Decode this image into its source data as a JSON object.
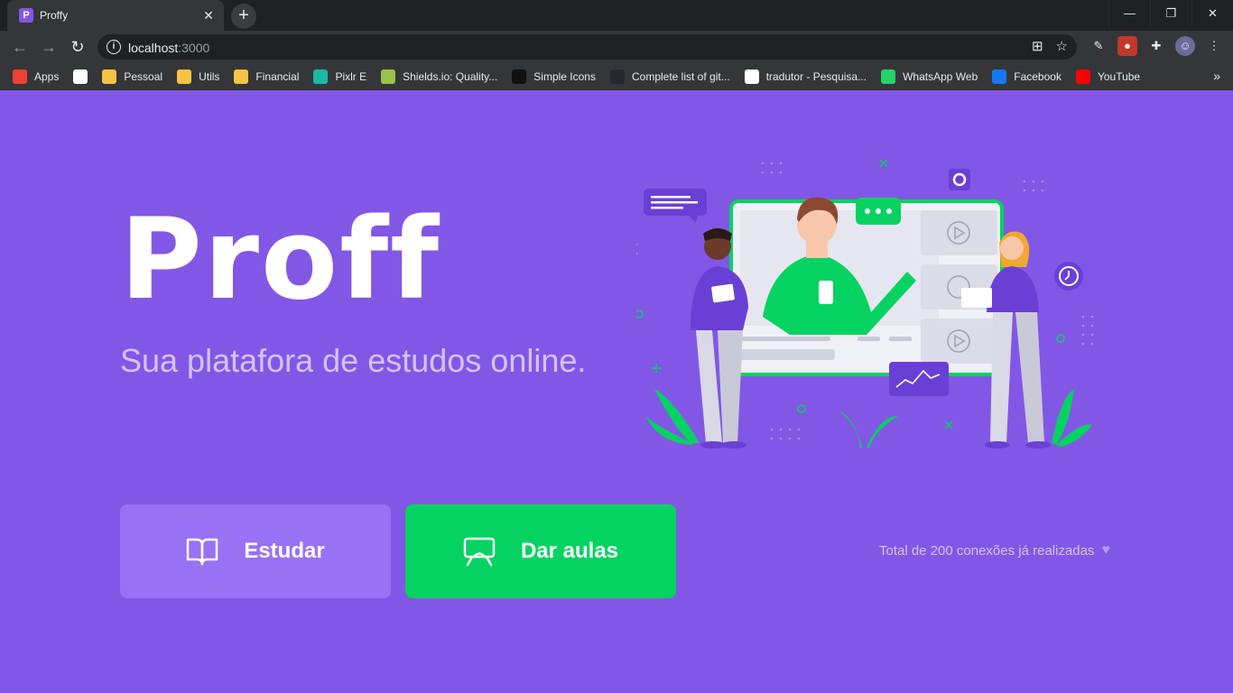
{
  "browser": {
    "tab_title": "Proffy",
    "tab_close": "✕",
    "new_tab": "+",
    "favicon_letter": "P",
    "url_host": "localhost",
    "url_port": ":3000",
    "window_controls": {
      "minimize": "—",
      "restore": "❐",
      "close": "✕"
    }
  },
  "bookmarks": [
    {
      "label": "Apps",
      "color": "#ea4335"
    },
    {
      "label": "",
      "color": "#ffffff"
    },
    {
      "label": "Pessoal",
      "color": "#f6c344"
    },
    {
      "label": "Utils",
      "color": "#f6c344"
    },
    {
      "label": "Financial",
      "color": "#f6c344"
    },
    {
      "label": "Pixlr E",
      "color": "#1bb8a8"
    },
    {
      "label": "Shields.io: Quality...",
      "color": "#97c34b"
    },
    {
      "label": "Simple Icons",
      "color": "#111111"
    },
    {
      "label": "Complete list of git...",
      "color": "#24292e"
    },
    {
      "label": "tradutor - Pesquisa...",
      "color": "#ffffff"
    },
    {
      "label": "WhatsApp Web",
      "color": "#25d366"
    },
    {
      "label": "Facebook",
      "color": "#1877f2"
    },
    {
      "label": "YouTube",
      "color": "#ff0000"
    }
  ],
  "page": {
    "logo": "Proff",
    "tagline": "Sua platafora de estudos online.",
    "study_button": "Estudar",
    "teach_button": "Dar aulas",
    "connections_text": "Total de 200 conexões já realizadas",
    "heart": "♥"
  },
  "colors": {
    "primary": "#8257e5",
    "primary_lighter": "#9871f5",
    "secondary": "#04d361",
    "text_light": "#d4c2ff"
  }
}
